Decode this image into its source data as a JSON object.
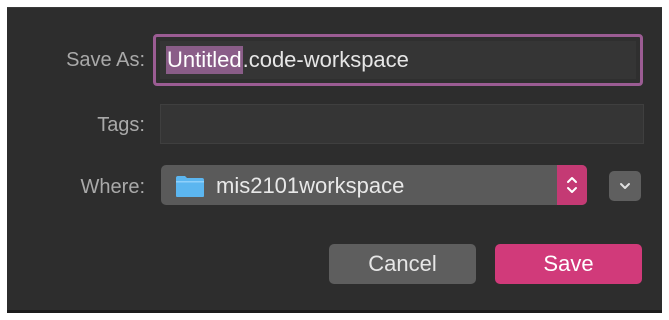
{
  "dialog": {
    "save_as_label": "Save As:",
    "filename_selected": "Untitled",
    "filename_rest": ".code-workspace",
    "tags_label": "Tags:",
    "tags_value": "",
    "where_label": "Where:",
    "where_value": "mis2101workspace",
    "cancel_label": "Cancel",
    "save_label": "Save"
  },
  "icons": {
    "folder": "folder-icon",
    "stepper": "updown-chevron-icon",
    "expand": "chevron-down-icon"
  },
  "colors": {
    "background": "#2d2d2d",
    "accent": "#d13a7a",
    "focus_ring": "#9b5c93",
    "selection": "#8a5d88",
    "folder": "#5cb6f0"
  }
}
